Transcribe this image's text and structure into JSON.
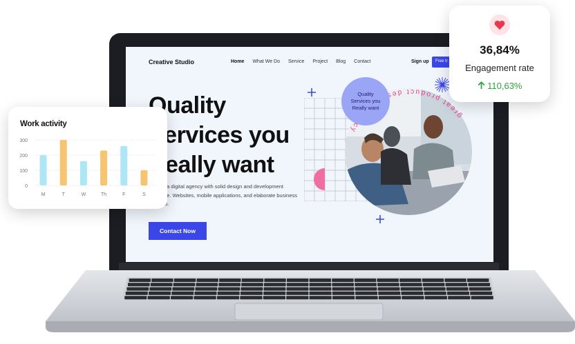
{
  "site": {
    "brand": "Creative Studio",
    "nav": [
      "Home",
      "What We Do",
      "Service",
      "Project",
      "Blog",
      "Contact"
    ],
    "active_nav": "Home",
    "signup": "Sign up",
    "free_trial": "Free tr",
    "hero_title": [
      "Quality",
      "Services you",
      "Really want"
    ],
    "hero_desc": "We are a digital agency with solid design and development expertise. Websites, mobile applications, and elaborate business services.",
    "cta": "Contact Now",
    "badge": [
      "Quality",
      "Services you",
      "Really want"
    ],
    "circular_text": "great product design agency",
    "colors": {
      "accent": "#3b46e8",
      "badge": "#9aa6f5",
      "pink": "#f06ea0"
    }
  },
  "work_activity": {
    "title": "Work activity"
  },
  "engagement": {
    "icon": "heart-icon",
    "value": "36,84%",
    "label": "Engagement rate",
    "growth_icon": "arrow-up-icon",
    "growth": "110,63%",
    "colors": {
      "heart": "#e8384f",
      "growth": "#2aa33d"
    }
  },
  "chart_data": {
    "type": "bar",
    "title": "Work activity",
    "categories": [
      "M",
      "T",
      "W",
      "Th",
      "F",
      "S"
    ],
    "values": [
      200,
      300,
      160,
      230,
      260,
      100
    ],
    "bar_colors": [
      "#aee6f5",
      "#f7c56f",
      "#aee6f5",
      "#f7c56f",
      "#aee6f5",
      "#f7c56f"
    ],
    "yticks": [
      0,
      100,
      200,
      300
    ],
    "ylim": [
      0,
      300
    ],
    "grid": true
  }
}
